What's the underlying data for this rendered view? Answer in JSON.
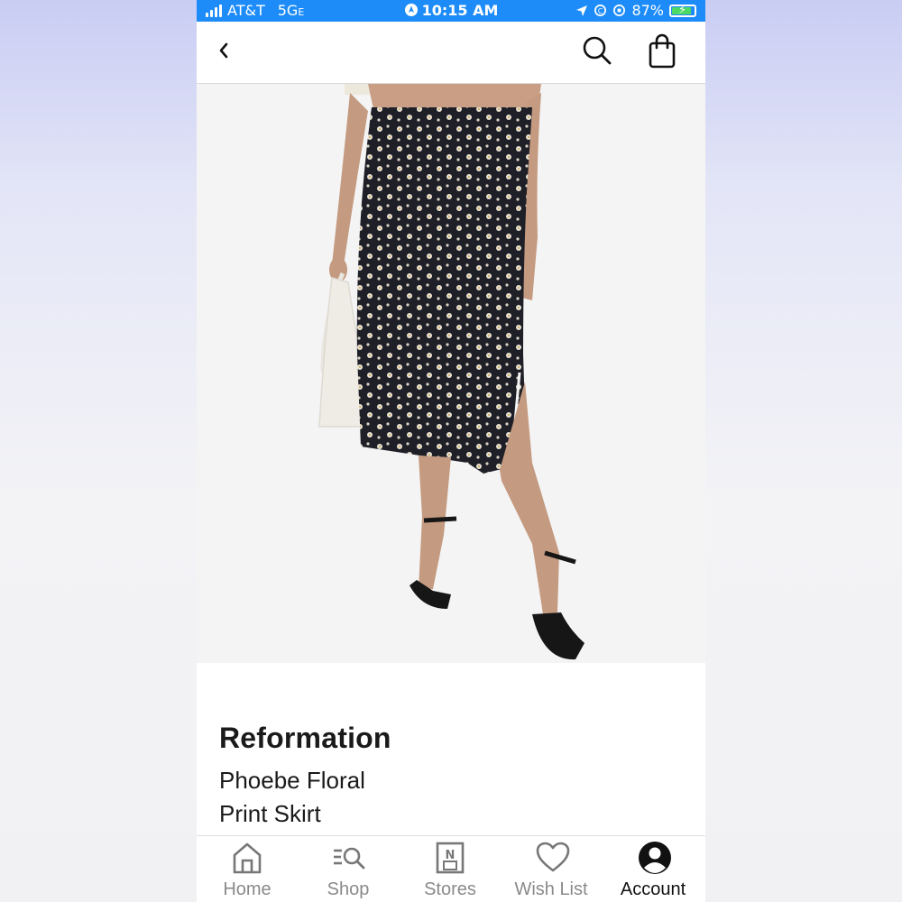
{
  "status_bar": {
    "carrier": "AT&T",
    "network": "5G",
    "network_suffix": "E",
    "time": "10:15 AM",
    "battery": "87%"
  },
  "nav": {
    "back_icon": "chevron-left-icon",
    "search_icon": "search-icon",
    "bag_icon": "shopping-bag-icon"
  },
  "product": {
    "brand": "Reformation",
    "name_line1": "Phoebe Floral",
    "name_line2": "Print Skirt"
  },
  "tabbar": {
    "items": [
      {
        "label": "Home",
        "icon": "home-icon"
      },
      {
        "label": "Shop",
        "icon": "shop-search-icon"
      },
      {
        "label": "Stores",
        "icon": "stores-icon"
      },
      {
        "label": "Wish List",
        "icon": "heart-icon"
      },
      {
        "label": "Account",
        "icon": "account-icon"
      }
    ],
    "active": "Account"
  },
  "colors": {
    "status_bar": "#1d8cf8",
    "text": "#1a1a1a",
    "tab_inactive": "#8a8a8a",
    "battery_fill": "#4cd964"
  }
}
